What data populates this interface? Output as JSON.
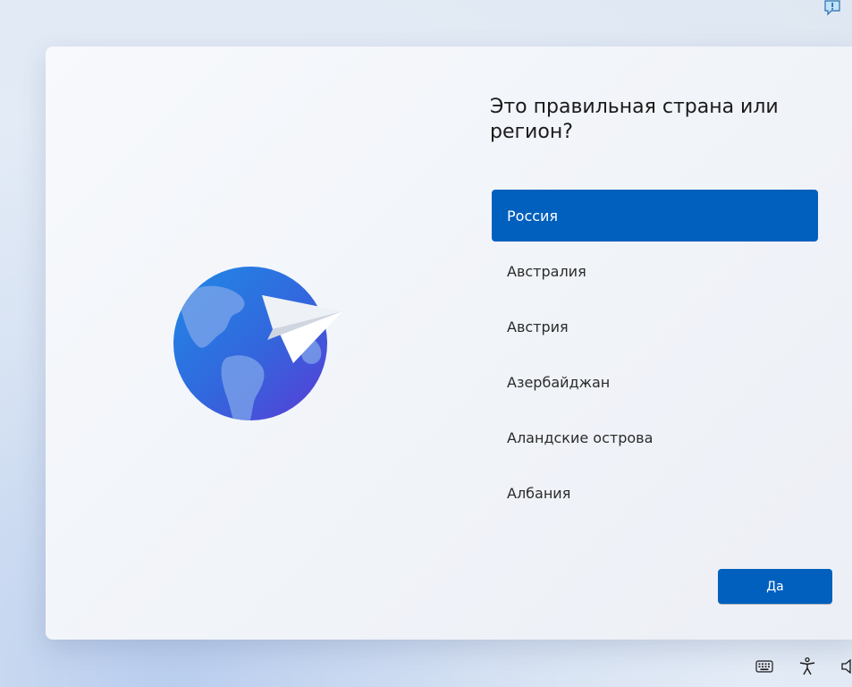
{
  "title": "Это правильная страна или регион?",
  "countries": [
    {
      "label": "Россия",
      "selected": true
    },
    {
      "label": "Австралия",
      "selected": false
    },
    {
      "label": "Австрия",
      "selected": false
    },
    {
      "label": "Азербайджан",
      "selected": false
    },
    {
      "label": "Аландские острова",
      "selected": false
    },
    {
      "label": "Албания",
      "selected": false
    }
  ],
  "yes_button": "Да",
  "accent_color": "#0160be",
  "icons": {
    "feedback": "feedback-icon",
    "illustration": "globe-paper-plane-icon",
    "keyboard": "keyboard-icon",
    "accessibility": "accessibility-icon",
    "volume": "volume-icon"
  }
}
